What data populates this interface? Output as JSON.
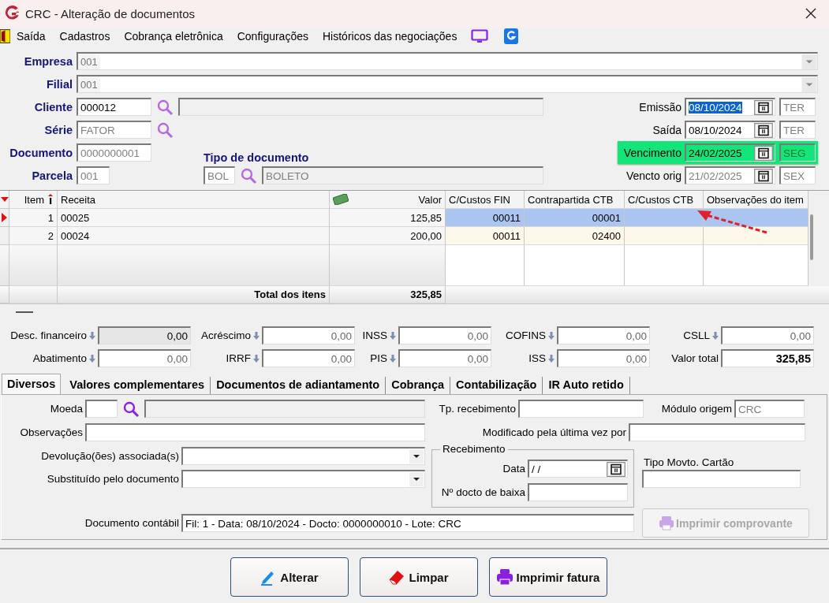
{
  "window": {
    "title": "CRC - Alteração de documentos"
  },
  "menu": [
    "Saída",
    "Cadastros",
    "Cobrança eletrônica",
    "Configurações",
    "Históricos das negociações"
  ],
  "empresa": {
    "label": "Empresa",
    "code": "001"
  },
  "filial": {
    "label": "Filial",
    "code": "001"
  },
  "cliente": {
    "label": "Cliente",
    "code": "000012",
    "disabled": false
  },
  "serie": {
    "label": "Série",
    "value": "FATOR",
    "disabled": true
  },
  "documento": {
    "label": "Documento",
    "value": "0000000001",
    "disabled": true
  },
  "parcela": {
    "label": "Parcela",
    "value": "001",
    "disabled": true
  },
  "tipo_documento": {
    "label": "Tipo de documento",
    "code": "BOL",
    "name": "BOLETO"
  },
  "dates": [
    {
      "label": "Emissão",
      "value": "08/10/2024",
      "day": "TER",
      "text_selected": true,
      "highlighted": false,
      "disabled": false
    },
    {
      "label": "Saída",
      "value": "08/10/2024",
      "day": "TER",
      "text_selected": false,
      "highlighted": false,
      "disabled": false
    },
    {
      "label": "Vencimento",
      "value": "24/02/2025",
      "day": "SEG",
      "text_selected": false,
      "highlighted": true,
      "disabled": false
    },
    {
      "label": "Vencto orig",
      "value": "21/02/2025",
      "day": "SEX",
      "text_selected": false,
      "highlighted": false,
      "disabled": true
    }
  ],
  "items_table": {
    "columns": [
      "Item",
      "Receita",
      "Valor",
      "C/Custos FIN",
      "Contrapartida CTB",
      "C/Custos CTB",
      "Observações do item"
    ],
    "rows": [
      {
        "cells": [
          "1",
          "00025",
          "125,85",
          "00011",
          "00001"
        ],
        "selected": true
      },
      {
        "cells": [
          "2",
          "00024",
          "200,00",
          "00011",
          "02400"
        ],
        "selected": false
      }
    ],
    "total_label": "Total dos itens",
    "total": "325,85"
  },
  "totals": [
    {
      "label": "Desc. financeiro",
      "value": "0,00",
      "kind": "adjust",
      "readonly": true
    },
    {
      "label": "Acréscimo",
      "value": "0,00",
      "kind": "adjust",
      "readonly": false
    },
    {
      "label": "INSS",
      "value": "0,00",
      "kind": "adjust",
      "readonly": false
    },
    {
      "label": "COFINS",
      "value": "0,00",
      "kind": "adjust",
      "readonly": false
    },
    {
      "label": "CSLL",
      "value": "0,00",
      "kind": "adjust",
      "readonly": false
    },
    {
      "label": "Abatimento",
      "value": "0,00",
      "kind": "adjust",
      "readonly": false
    },
    {
      "label": "IRRF",
      "value": "0,00",
      "kind": "adjust",
      "readonly": false
    },
    {
      "label": "PIS",
      "value": "0,00",
      "kind": "adjust",
      "readonly": false
    },
    {
      "label": "ISS",
      "value": "0,00",
      "kind": "adjust",
      "readonly": false
    },
    {
      "label": "Valor total",
      "value": "325,85",
      "kind": "total",
      "readonly": false
    }
  ],
  "tabs": [
    {
      "label": "Diversos",
      "selected": true
    },
    {
      "label": "Valores complementares",
      "selected": false
    },
    {
      "label": "Documentos de adiantamento",
      "selected": false
    },
    {
      "label": "Cobrança",
      "selected": false
    },
    {
      "label": "Contabilização",
      "selected": false
    },
    {
      "label": "IR Auto retido",
      "selected": false
    }
  ],
  "diversos": {
    "moeda": "Moeda",
    "tp_recebimento": "Tp. recebimento",
    "modulo_origem": {
      "label": "Módulo origem",
      "value": "CRC"
    },
    "observacoes": "Observações",
    "modificado": "Modificado pela última vez por",
    "devolucoes": "Devolução(ões) associada(s)",
    "substituido": "Substituído pelo documento",
    "recebimento": {
      "title": "Recebimento",
      "data_label": "Data",
      "data_value": "/ /",
      "docto_label": "Nº docto de baixa"
    },
    "tipo_movto": "Tipo Movto. Cartão",
    "documento_contabil": {
      "label": "Documento contábil",
      "value": "Fil: 1 - Data: 08/10/2024 - Docto: 0000000010 - Lote: CRC"
    },
    "print_button": {
      "label": "Imprimir comprovante",
      "disabled": true
    }
  },
  "buttons": [
    {
      "label": "Alterar",
      "kind": "edit"
    },
    {
      "label": "Limpar",
      "kind": "clear"
    },
    {
      "label": "Imprimir fatura",
      "kind": "print"
    }
  ]
}
